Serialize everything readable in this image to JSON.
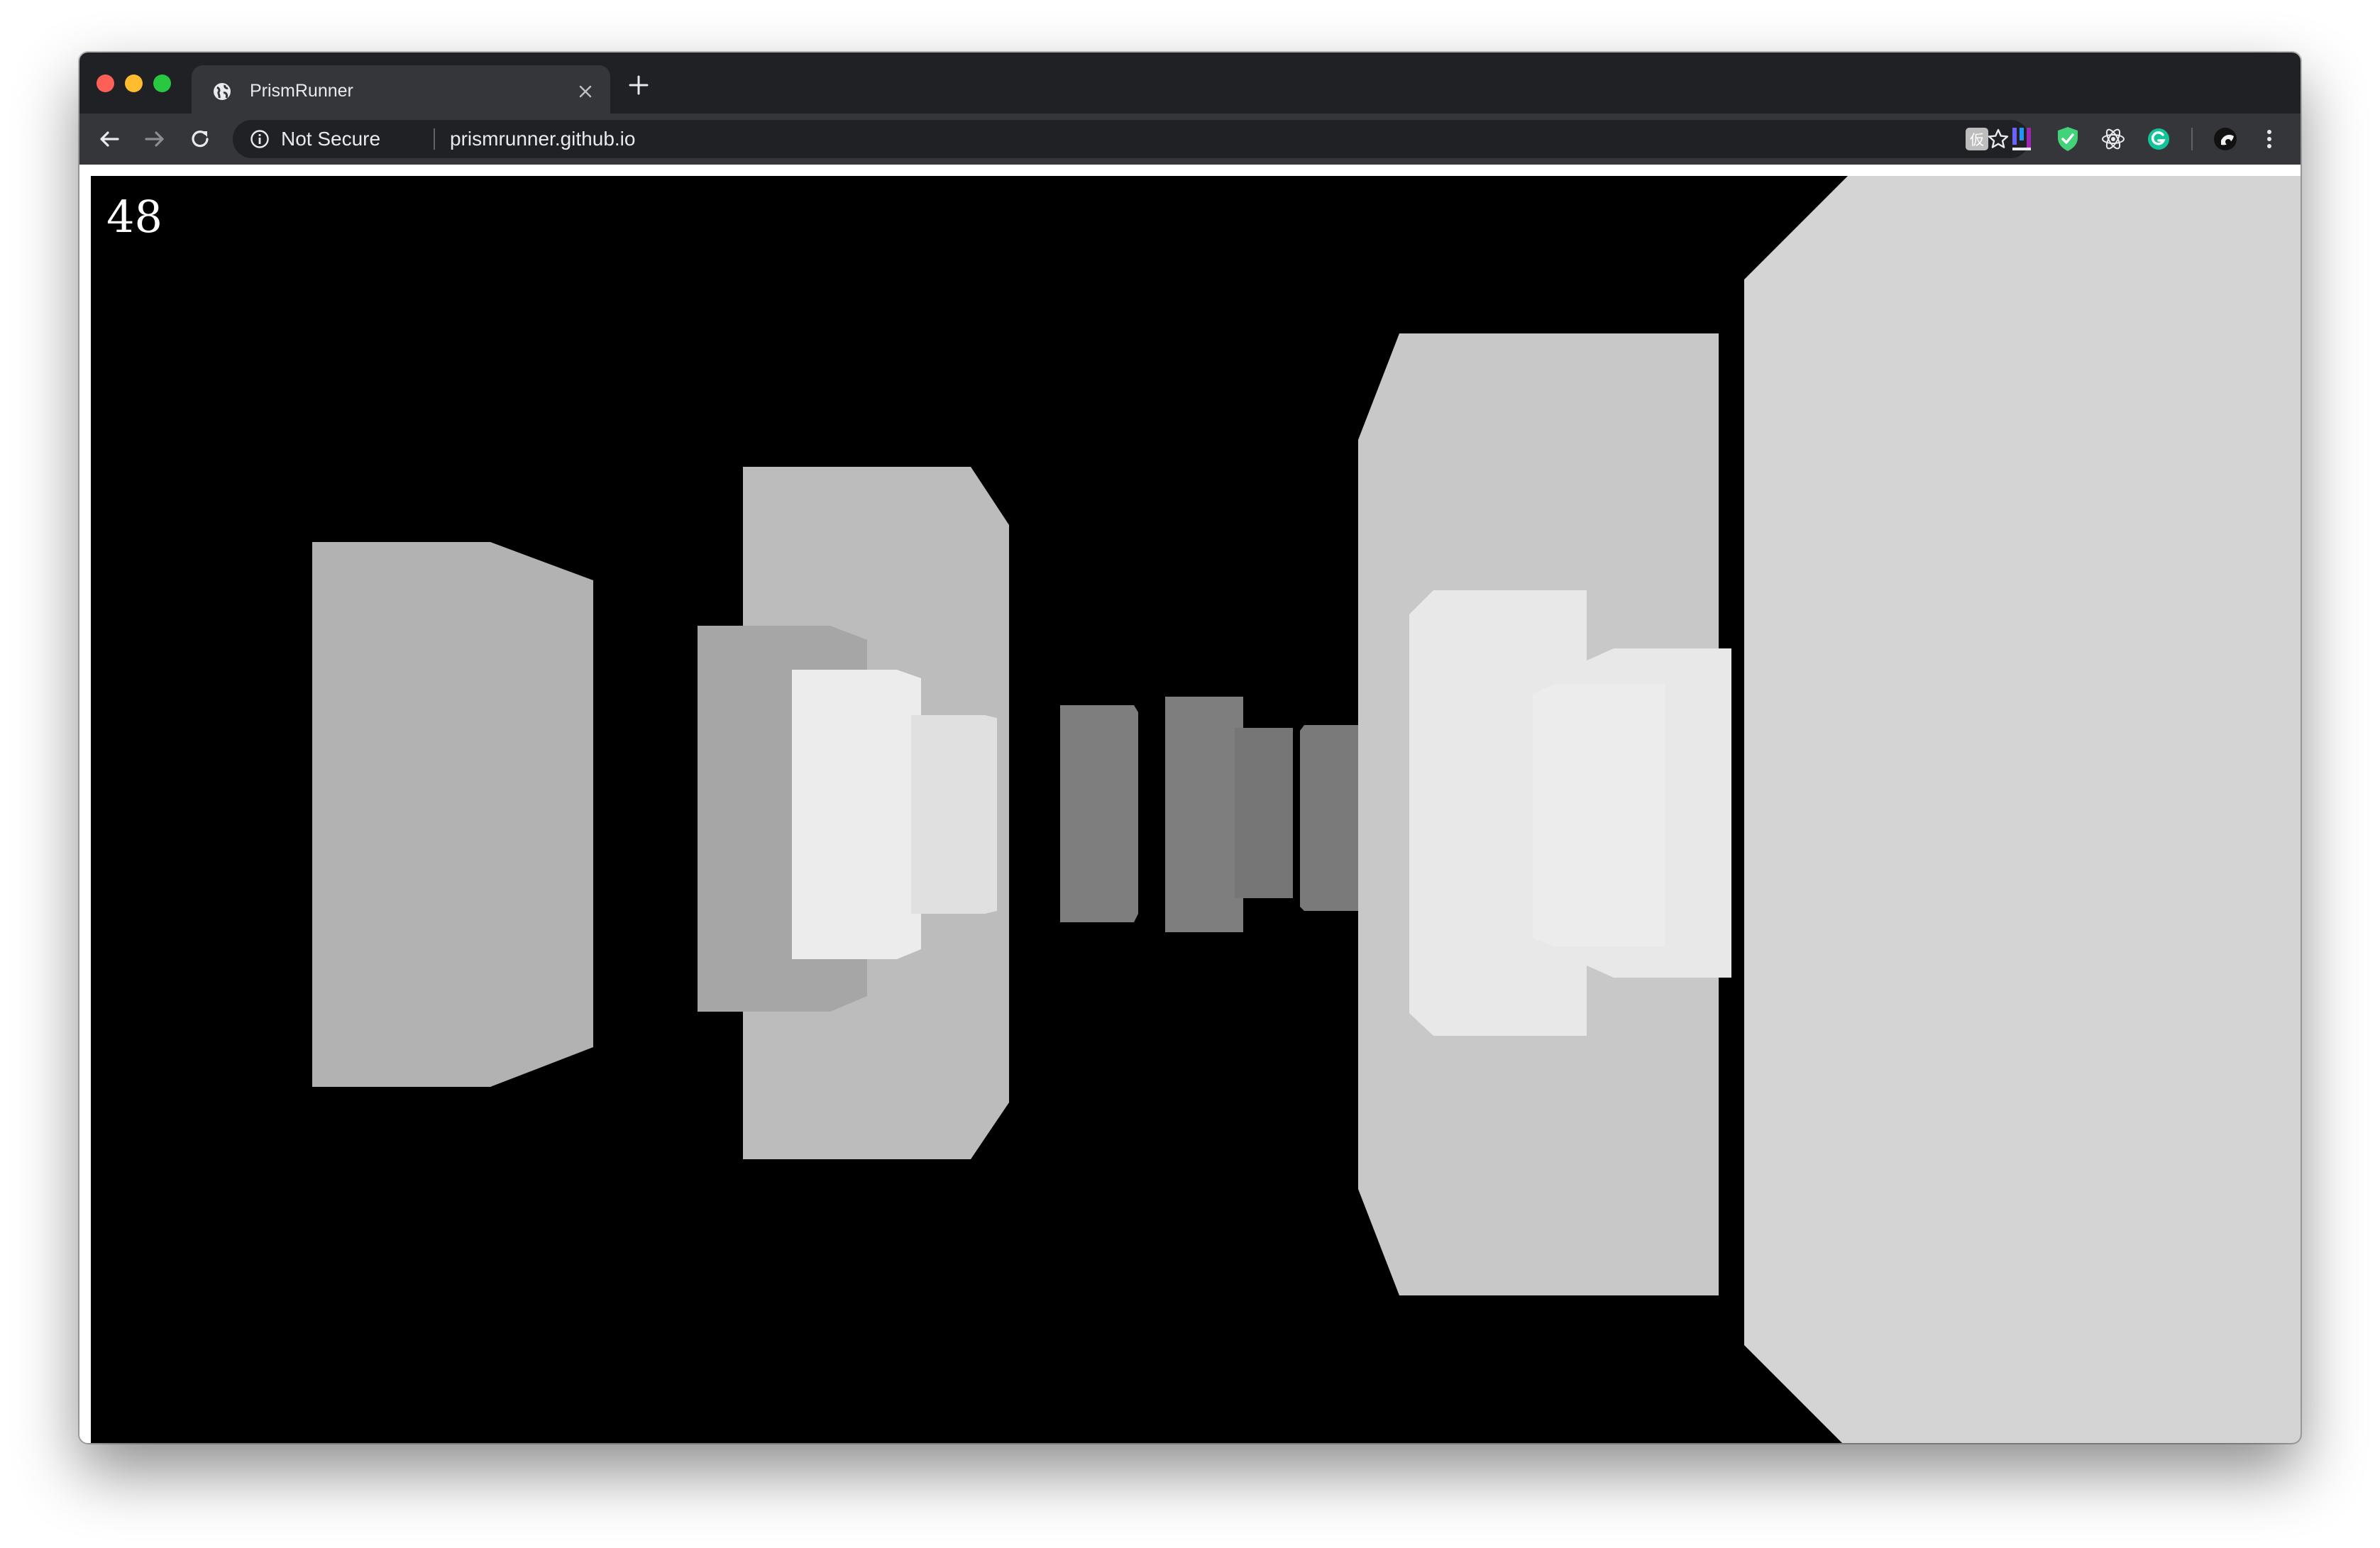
{
  "browser": {
    "tab": {
      "title": "PrismRunner",
      "favicon": "globe-icon"
    },
    "address_bar": {
      "security_label": "Not Secure",
      "url": "prismrunner.github.io"
    },
    "nav_icons": [
      "back-arrow-icon",
      "forward-arrow-icon",
      "reload-icon"
    ],
    "extension_icons": [
      "kanji-extension-icon",
      "ij-extension-icon",
      "shield-check-icon",
      "react-devtools-icon",
      "grammarly-icon",
      "profile-avatar-icon",
      "more-menu-icon"
    ]
  },
  "game": {
    "score": "48",
    "background_color": "#000000",
    "prism_colors": [
      "#b2b2b2",
      "#bcbcbc",
      "#a6a6a6",
      "#ececec",
      "#e0e0e0",
      "#7e7e7e",
      "#c8c8c8",
      "#e8e8e8",
      "#d4d4d4"
    ]
  }
}
